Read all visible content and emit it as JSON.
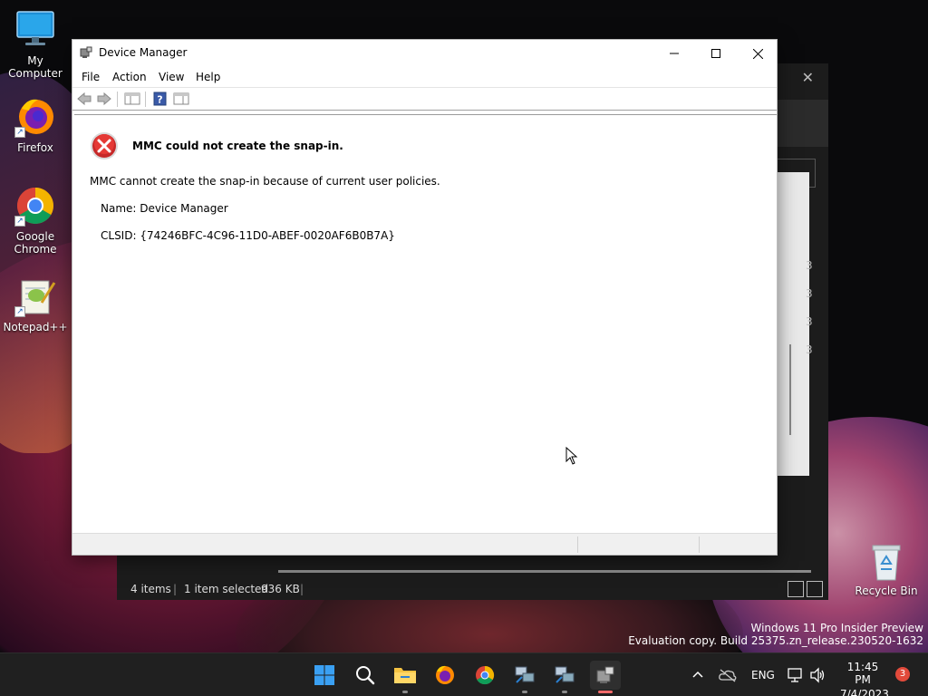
{
  "desktop": {
    "icons": [
      {
        "label": "My Computer"
      },
      {
        "label": "Firefox"
      },
      {
        "label": "Google Chrome"
      },
      {
        "label": "Notepad++"
      }
    ],
    "recycle_bin_label": "Recycle Bin",
    "watermark": {
      "line1": "Windows 11 Pro Insider Preview",
      "line2": "Evaluation copy. Build 25375.zn_release.230520-1632"
    }
  },
  "explorer": {
    "status_items": "4 items",
    "status_selected": "1 item selected",
    "status_size": "936 KB",
    "row_nums": [
      "3",
      "3",
      "3",
      "3"
    ]
  },
  "device_manager": {
    "title": "Device Manager",
    "menu": {
      "file": "File",
      "action": "Action",
      "view": "View",
      "help": "Help"
    },
    "error": {
      "title": "MMC could not create the snap-in.",
      "message": "MMC cannot create the snap-in because of current user policies.",
      "name_line": "Name: Device Manager",
      "clsid_line": "CLSID: {74246BFC-4C96-11D0-ABEF-0020AF6B0B7A}"
    }
  },
  "taskbar": {
    "language": "ENG",
    "time": "11:45 PM",
    "date": "7/4/2023",
    "notification_count": "3"
  },
  "colors": {
    "error_red": "#d32f2f",
    "taskbar_bg": "#202020",
    "windows_blue": "#0078d4"
  }
}
